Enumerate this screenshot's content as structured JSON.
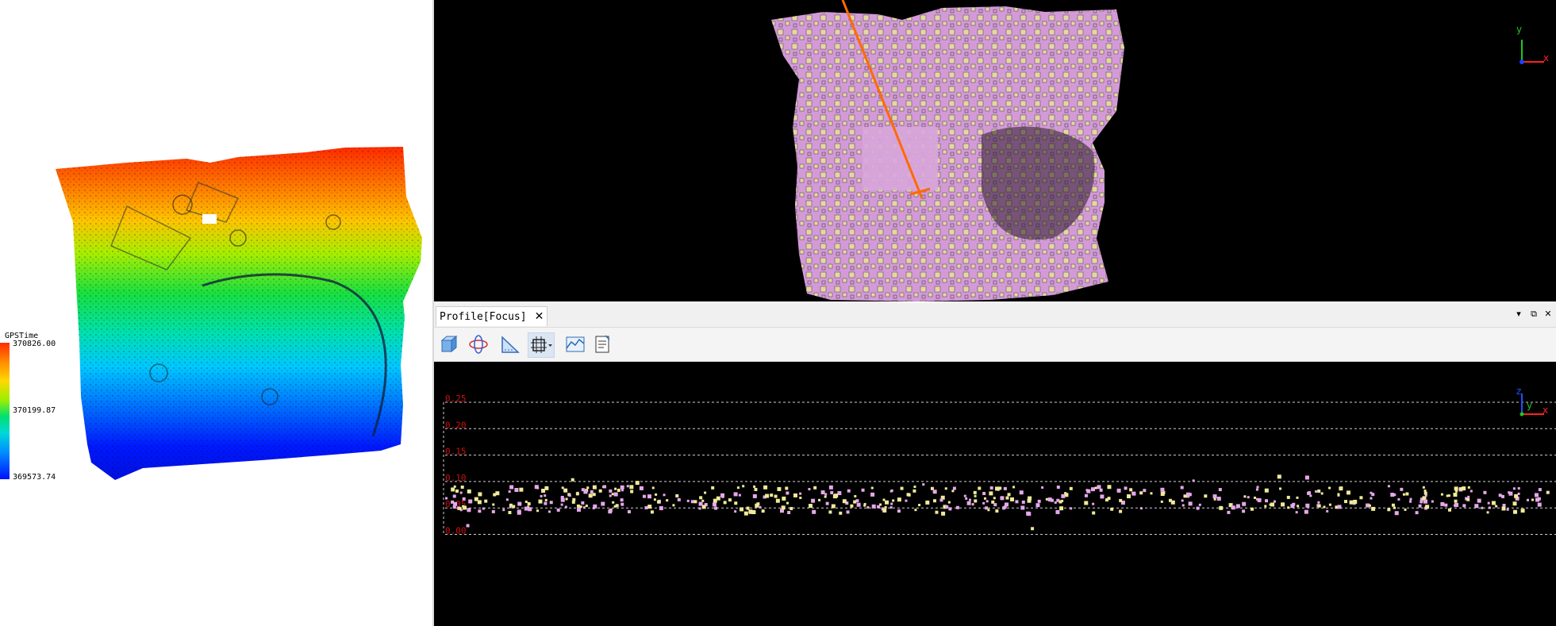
{
  "left_view": {
    "legend": {
      "title": "GPSTime",
      "max_label": "370826.00",
      "mid_label": "370199.87",
      "min_label": "369573.74"
    }
  },
  "top_view": {
    "axis_y": "y",
    "axis_x": "x"
  },
  "profile_panel": {
    "tab_title": "Profile[Focus]",
    "tab_close": "✕",
    "window_buttons": {
      "menu": "▾",
      "restore": "⧉",
      "close": "✕"
    },
    "toolbar": [
      "3d-view-icon",
      "orbit-icon",
      "measure-icon",
      "grid-select-icon",
      "profile-icon",
      "report-icon"
    ],
    "axis_z": "z",
    "axis_y": "y",
    "axis_x": "x",
    "y_ticks": [
      "0.25",
      "0.20",
      "0.15",
      "0.10",
      "0.05",
      "0.00"
    ]
  },
  "colors": {
    "background_dark": "#000000",
    "profile_tick": "#d01010",
    "point_pink": "#e6a8ea",
    "point_yellow": "#eeea98",
    "cut_line": "#ff6a00"
  }
}
